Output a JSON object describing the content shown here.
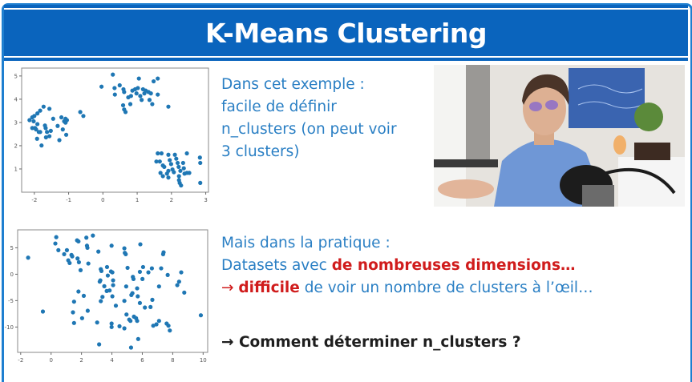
{
  "slide": {
    "title": "K-Means Clustering",
    "block1": {
      "lines": [
        "Dans cet exemple :",
        "facile de définir",
        "n_clusters (on peut voir",
        "3 clusters)"
      ]
    },
    "block2": {
      "line1": "Mais dans la pratique :",
      "line2_prefix": "Datasets avec ",
      "line2_highlight": "de nombreuses dimensions…",
      "line3_arrow": "→ ",
      "line3_highlight": "difficile",
      "line3_rest": " de voir un nombre de clusters à l’œil…",
      "question": "→ Comment déterminer n_clusters ?"
    },
    "webcam": {
      "description_icon": "presenter-video"
    },
    "colors": {
      "title_bar": "#0a64bd",
      "text_blue": "#2a7fc4",
      "highlight_red": "#d01c1c",
      "point": "#1f77b4"
    }
  },
  "chart_data": [
    {
      "type": "scatter",
      "xlim": [
        -2.37,
        3.08
      ],
      "ylim": [
        0.0,
        5.34
      ],
      "xticks": [
        "-2",
        "-1",
        "0",
        "1",
        "2",
        "3"
      ],
      "yticks": [
        "1",
        "2",
        "3",
        "4",
        "5"
      ],
      "grid": false,
      "points": [
        [
          -2.14,
          3.1
        ],
        [
          -2.06,
          3.22
        ],
        [
          -2.02,
          3.05
        ],
        [
          -1.98,
          2.76
        ],
        [
          -2.06,
          2.76
        ],
        [
          -1.95,
          2.7
        ],
        [
          -2.0,
          3.28
        ],
        [
          -1.91,
          3.39
        ],
        [
          -1.83,
          3.51
        ],
        [
          -1.73,
          3.68
        ],
        [
          -1.56,
          3.59
        ],
        [
          -1.91,
          2.93
        ],
        [
          -1.87,
          2.59
        ],
        [
          -1.83,
          2.59
        ],
        [
          -1.92,
          2.3
        ],
        [
          -1.79,
          2.01
        ],
        [
          -1.69,
          2.87
        ],
        [
          -1.67,
          2.76
        ],
        [
          -1.63,
          2.59
        ],
        [
          -1.66,
          2.36
        ],
        [
          -1.56,
          2.41
        ],
        [
          -1.52,
          2.64
        ],
        [
          -1.45,
          3.16
        ],
        [
          -1.32,
          2.85
        ],
        [
          -1.27,
          2.24
        ],
        [
          -1.21,
          3.22
        ],
        [
          -1.17,
          2.7
        ],
        [
          -1.13,
          3.05
        ],
        [
          -1.09,
          2.99
        ],
        [
          -1.05,
          3.1
        ],
        [
          -1.09,
          3.16
        ],
        [
          -1.07,
          2.47
        ],
        [
          -0.66,
          3.45
        ],
        [
          -0.57,
          3.28
        ],
        [
          -0.04,
          4.54
        ],
        [
          0.29,
          5.06
        ],
        [
          0.34,
          4.48
        ],
        [
          0.35,
          4.2
        ],
        [
          0.49,
          4.6
        ],
        [
          0.6,
          4.43
        ],
        [
          0.62,
          4.31
        ],
        [
          0.59,
          3.74
        ],
        [
          0.62,
          3.56
        ],
        [
          0.66,
          3.45
        ],
        [
          0.74,
          4.08
        ],
        [
          0.82,
          4.14
        ],
        [
          0.86,
          4.37
        ],
        [
          0.94,
          4.43
        ],
        [
          0.98,
          4.25
        ],
        [
          1.02,
          4.48
        ],
        [
          1.05,
          4.89
        ],
        [
          1.09,
          4.14
        ],
        [
          1.13,
          3.97
        ],
        [
          1.17,
          4.43
        ],
        [
          1.21,
          4.25
        ],
        [
          1.25,
          4.37
        ],
        [
          1.33,
          4.31
        ],
        [
          1.36,
          3.97
        ],
        [
          1.4,
          4.25
        ],
        [
          1.44,
          3.79
        ],
        [
          1.48,
          4.77
        ],
        [
          1.6,
          4.89
        ],
        [
          1.6,
          4.2
        ],
        [
          1.91,
          3.68
        ],
        [
          0.8,
          3.79
        ],
        [
          1.6,
          1.67
        ],
        [
          1.71,
          1.67
        ],
        [
          1.56,
          1.32
        ],
        [
          1.66,
          1.32
        ],
        [
          1.75,
          1.15
        ],
        [
          1.79,
          1.09
        ],
        [
          1.87,
          0.8
        ],
        [
          1.75,
          0.69
        ],
        [
          1.91,
          1.61
        ],
        [
          1.95,
          1.38
        ],
        [
          1.99,
          1.21
        ],
        [
          2.03,
          0.98
        ],
        [
          1.91,
          0.63
        ],
        [
          2.1,
          1.61
        ],
        [
          2.14,
          1.44
        ],
        [
          2.18,
          1.26
        ],
        [
          2.21,
          1.09
        ],
        [
          2.26,
          0.92
        ],
        [
          2.22,
          0.69
        ],
        [
          2.22,
          0.52
        ],
        [
          2.24,
          0.4
        ],
        [
          2.28,
          0.29
        ],
        [
          2.34,
          1.26
        ],
        [
          2.36,
          1.03
        ],
        [
          2.38,
          0.8
        ],
        [
          2.45,
          0.83
        ],
        [
          2.52,
          0.83
        ],
        [
          2.45,
          1.67
        ],
        [
          2.83,
          1.49
        ],
        [
          2.84,
          1.26
        ],
        [
          2.84,
          0.4
        ],
        [
          1.91,
          0.92
        ],
        [
          2.07,
          0.86
        ],
        [
          1.68,
          0.83
        ]
      ]
    },
    {
      "type": "scatter",
      "xlim": [
        -2.2,
        10.3
      ],
      "ylim": [
        -14.8,
        8.4
      ],
      "xticks": [
        "-2",
        "0",
        "2",
        "4",
        "6",
        "8",
        "10"
      ],
      "yticks": [
        "5",
        "0",
        "-5",
        "-10"
      ],
      "grid": false,
      "points": [
        [
          -1.51,
          3.13
        ],
        [
          -0.54,
          -7.07
        ],
        [
          0.34,
          7.02
        ],
        [
          0.28,
          5.81
        ],
        [
          0.48,
          4.55
        ],
        [
          0.86,
          3.79
        ],
        [
          1.04,
          4.55
        ],
        [
          1.13,
          2.63
        ],
        [
          1.22,
          2.12
        ],
        [
          1.34,
          3.64
        ],
        [
          1.39,
          3.38
        ],
        [
          1.71,
          6.41
        ],
        [
          1.8,
          6.21
        ],
        [
          1.74,
          2.98
        ],
        [
          1.83,
          2.27
        ],
        [
          1.94,
          0.76
        ],
        [
          1.8,
          -3.28
        ],
        [
          2.15,
          -4.09
        ],
        [
          1.51,
          -5.2
        ],
        [
          1.51,
          -9.24
        ],
        [
          1.44,
          -7.22
        ],
        [
          2.04,
          -8.33
        ],
        [
          2.41,
          -6.92
        ],
        [
          2.32,
          6.92
        ],
        [
          2.36,
          5.4
        ],
        [
          2.39,
          5.0
        ],
        [
          2.45,
          2.02
        ],
        [
          2.75,
          7.32
        ],
        [
          3.11,
          4.29
        ],
        [
          3.03,
          -9.14
        ],
        [
          3.16,
          -13.28
        ],
        [
          3.24,
          -1.16
        ],
        [
          3.27,
          0.96
        ],
        [
          3.31,
          0.61
        ],
        [
          3.2,
          -1.41
        ],
        [
          3.38,
          -4.29
        ],
        [
          3.27,
          -5.1
        ],
        [
          3.5,
          -2.27
        ],
        [
          3.68,
          1.36
        ],
        [
          3.73,
          -0.25
        ],
        [
          3.66,
          -3.18
        ],
        [
          3.85,
          -3.08
        ],
        [
          3.94,
          0.51
        ],
        [
          4.03,
          0.35
        ],
        [
          4.08,
          -1.16
        ],
        [
          4.08,
          -2.07
        ],
        [
          3.98,
          5.4
        ],
        [
          3.98,
          -9.34
        ],
        [
          3.98,
          -10.0
        ],
        [
          4.03,
          -4.19
        ],
        [
          4.26,
          -5.96
        ],
        [
          4.5,
          -9.85
        ],
        [
          4.82,
          4.9
        ],
        [
          4.85,
          4.04
        ],
        [
          4.91,
          3.79
        ],
        [
          4.82,
          -5.05
        ],
        [
          4.82,
          -10.25
        ],
        [
          4.94,
          -2.32
        ],
        [
          4.96,
          -7.63
        ],
        [
          5.03,
          1.21
        ],
        [
          5.14,
          -8.59
        ],
        [
          5.22,
          -8.84
        ],
        [
          5.28,
          -3.94
        ],
        [
          5.35,
          -3.59
        ],
        [
          5.38,
          -0.51
        ],
        [
          5.42,
          -0.91
        ],
        [
          5.45,
          -8.03
        ],
        [
          5.59,
          -8.33
        ],
        [
          5.66,
          -8.84
        ],
        [
          5.66,
          -2.68
        ],
        [
          5.7,
          -4.19
        ],
        [
          5.73,
          -12.27
        ],
        [
          5.84,
          -5.45
        ],
        [
          5.87,
          5.66
        ],
        [
          5.84,
          0.45
        ],
        [
          6.01,
          -0.91
        ],
        [
          6.05,
          1.36
        ],
        [
          6.17,
          -6.31
        ],
        [
          6.4,
          0.35
        ],
        [
          6.54,
          -6.21
        ],
        [
          6.63,
          1.11
        ],
        [
          6.72,
          -9.75
        ],
        [
          6.93,
          -9.49
        ],
        [
          7.1,
          -8.84
        ],
        [
          6.66,
          -4.85
        ],
        [
          7.1,
          -2.32
        ],
        [
          7.24,
          1.11
        ],
        [
          7.37,
          3.79
        ],
        [
          7.4,
          4.14
        ],
        [
          7.6,
          -9.34
        ],
        [
          7.67,
          -0.15
        ],
        [
          7.72,
          -9.75
        ],
        [
          7.81,
          -10.66
        ],
        [
          8.3,
          -2.07
        ],
        [
          8.42,
          -1.41
        ],
        [
          8.56,
          0.35
        ],
        [
          8.76,
          -3.48
        ],
        [
          9.85,
          -7.78
        ],
        [
          5.26,
          -13.89
        ]
      ]
    }
  ]
}
